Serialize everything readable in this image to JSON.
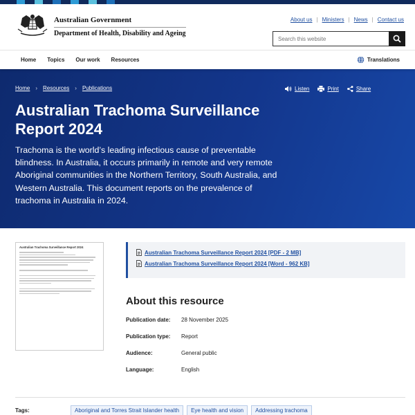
{
  "colors": {
    "stripe": [
      "#1d6fb8",
      "#2e9bd6",
      "#5bc0de",
      "#0d3a80"
    ],
    "hero_bg": "#13368c",
    "link": "#1f4fa0"
  },
  "header": {
    "gov_name": "Australian Government",
    "dept_name": "Department of Health, Disability and Ageing",
    "utility_links": [
      "About us",
      "Ministers",
      "News",
      "Contact us"
    ],
    "search_placeholder": "Search this website"
  },
  "nav": {
    "items": [
      "Home",
      "Topics",
      "Our work",
      "Resources"
    ],
    "translations": "Translations"
  },
  "hero": {
    "breadcrumb": [
      "Home",
      "Resources",
      "Publications"
    ],
    "tools": {
      "listen": "Listen",
      "print": "Print",
      "share": "Share"
    },
    "title": "Australian Trachoma Surveillance Report 2024",
    "summary": "Trachoma is the world’s leading infectious cause of preventable blindness. In Australia, it occurs primarily in remote and very remote Aboriginal communities in the Northern Territory, South Australia, and Western Australia. This document reports on the prevalence of trachoma in Australia in 2024."
  },
  "thumbnail": {
    "title": "Australian Trachoma Surveillance Report 2024"
  },
  "downloads": [
    "Australian Trachoma Surveillance Report 2024 [PDF - 2 MB]",
    "Australian Trachoma Surveillance Report 2024 [Word - 962 KB]"
  ],
  "about": {
    "heading": "About this resource",
    "rows": [
      {
        "label": "Publication date:",
        "value": "28 November 2025"
      },
      {
        "label": "Publication type:",
        "value": "Report"
      },
      {
        "label": "Audience:",
        "value": "General public"
      },
      {
        "label": "Language:",
        "value": "English"
      }
    ]
  },
  "tags": {
    "label": "Tags:",
    "items": [
      "Aboriginal and Torres Strait Islander health",
      "Eye health and vision",
      "Addressing trachoma"
    ]
  }
}
